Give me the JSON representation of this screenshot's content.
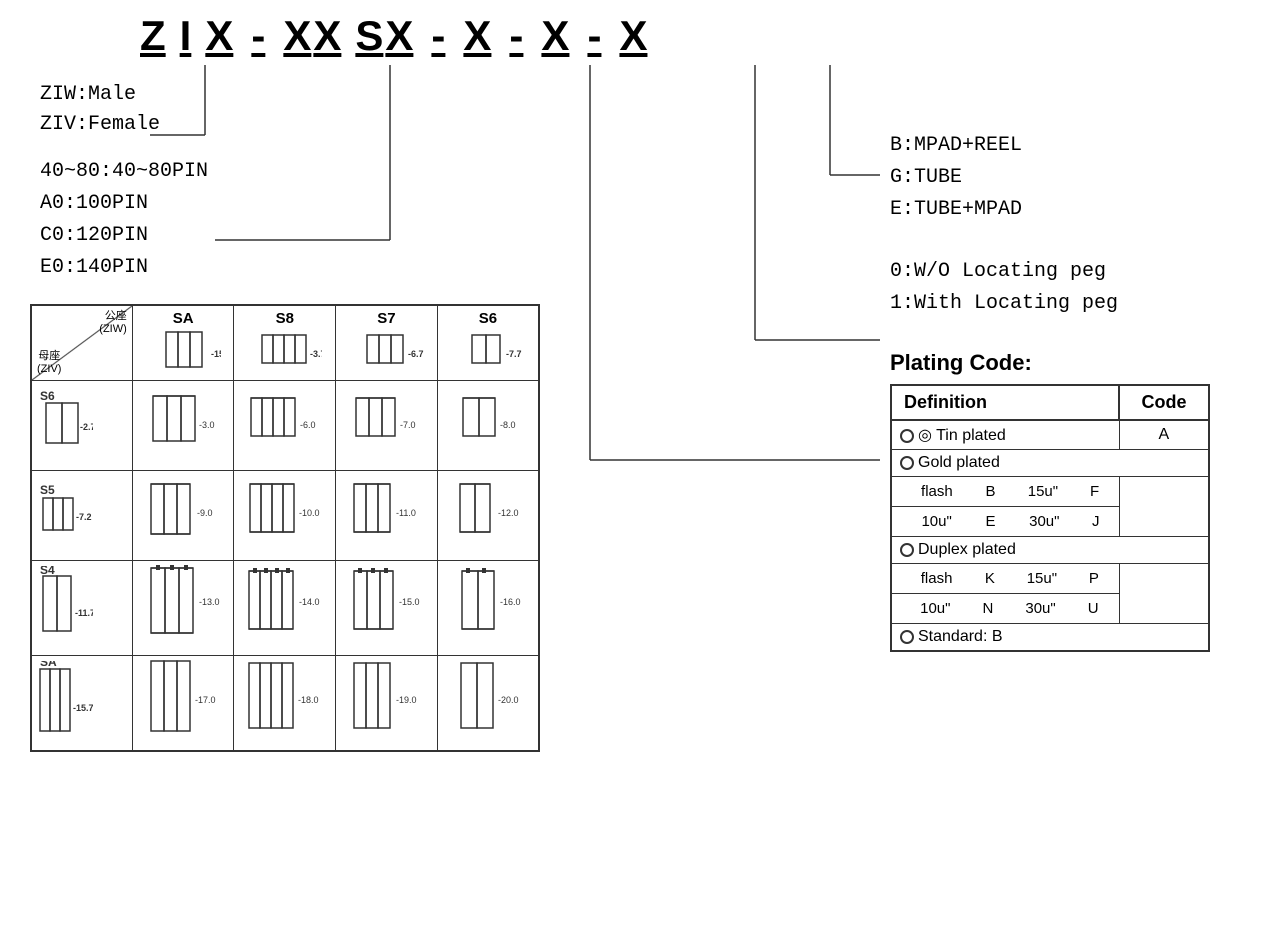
{
  "header": {
    "code_parts": [
      "Z",
      "I",
      "X",
      "-",
      "X",
      "X",
      "S",
      "X",
      "-",
      "X",
      "-",
      "X",
      "-",
      "X"
    ]
  },
  "type_labels": [
    "ZIW:Male",
    "ZIV:Female"
  ],
  "pin_labels": [
    "40~80:40~80PIN",
    "A0:100PIN",
    "C0:120PIN",
    "E0:140PIN"
  ],
  "packaging_labels": [
    "B:MPAD+REEL",
    "G:TUBE",
    "E:TUBE+MPAD"
  ],
  "locating_labels": [
    "0:W/O Locating peg",
    "1:With Locating peg"
  ],
  "plating": {
    "title": "Plating Code:",
    "header_def": "Definition",
    "header_code": "Code",
    "rows": [
      {
        "type": "header",
        "def": "◎ Tin plated",
        "code": "A"
      },
      {
        "type": "span",
        "def": "◎ Gold plated",
        "code": ""
      },
      {
        "type": "data",
        "def": "flash",
        "code1": "B",
        "code2": "15u\"",
        "code3": "F"
      },
      {
        "type": "data",
        "def": "10u\"",
        "code1": "E",
        "code2": "30u\"",
        "code3": "J"
      },
      {
        "type": "span",
        "def": "◎ Duplex plated",
        "code": ""
      },
      {
        "type": "data",
        "def": "flash",
        "code1": "K",
        "code2": "15u\"",
        "code3": "P"
      },
      {
        "type": "data",
        "def": "10u\"",
        "code1": "N",
        "code2": "30u\"",
        "code3": "U"
      },
      {
        "type": "span",
        "def": "◎ Standard: B",
        "code": ""
      }
    ]
  },
  "table": {
    "col_headers": [
      "SA",
      "S8",
      "S7",
      "S6"
    ],
    "diag_top": "公座\n(ZIW)",
    "diag_bottom": "母座\n(ZIV)",
    "rows": [
      {
        "label": "S6"
      },
      {
        "label": "S5"
      },
      {
        "label": "S4"
      },
      {
        "label": "SA"
      }
    ]
  }
}
